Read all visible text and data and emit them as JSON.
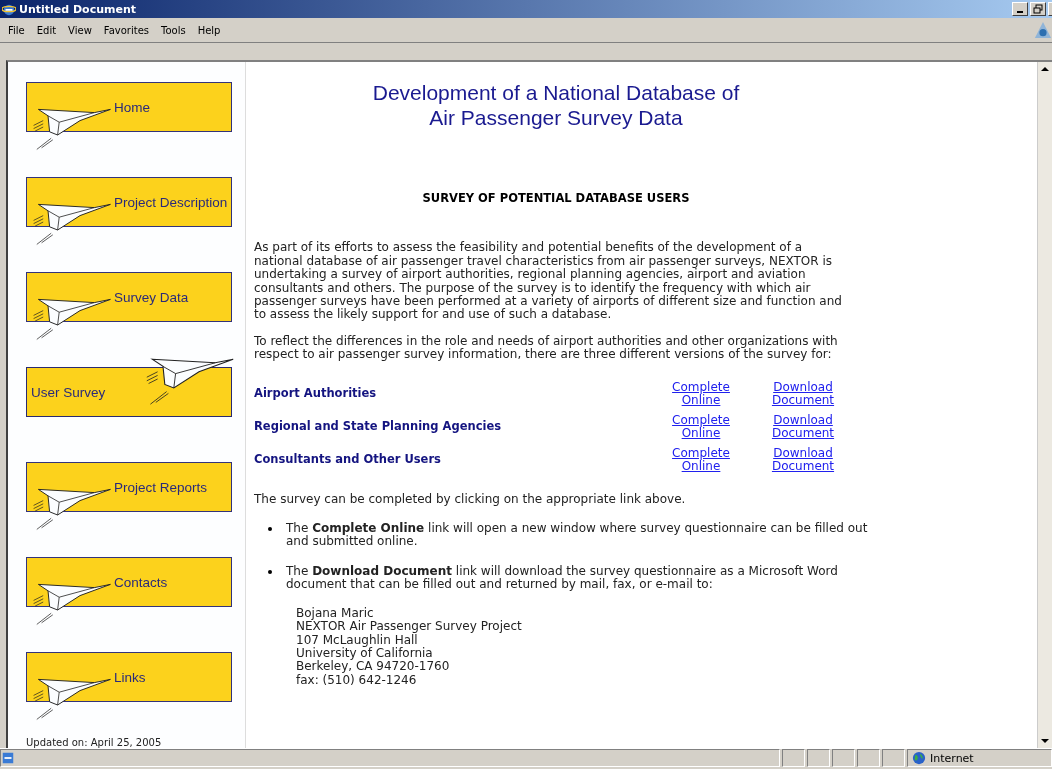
{
  "window": {
    "title": "Untitled Document"
  },
  "menu": [
    "File",
    "Edit",
    "View",
    "Favorites",
    "Tools",
    "Help"
  ],
  "sidebar": {
    "items": [
      {
        "label": "Home",
        "selected": false
      },
      {
        "label": "Project Description",
        "selected": false
      },
      {
        "label": "Survey Data",
        "selected": false
      },
      {
        "label": "User Survey",
        "selected": true
      },
      {
        "label": "Project Reports",
        "selected": false
      },
      {
        "label": "Contacts",
        "selected": false
      },
      {
        "label": "Links",
        "selected": false
      }
    ],
    "updated": "Updated on: April 25, 2005"
  },
  "page": {
    "title": "Development of a National Database of\nAir Passenger Survey Data",
    "heading": "SURVEY OF POTENTIAL DATABASE USERS",
    "paragraphs": [
      "As part of its efforts to assess the feasibility and potential benefits of the development of a national database of air passenger travel characteristics from air passenger surveys, NEXTOR is undertaking a survey of airport authorities, regional planning agencies, airport and aviation consultants and others. The purpose of the survey is to identify the frequency with which air passenger surveys have been performed at a variety of airports of different size and function and to assess the likely support for and use of such a database.",
      "To reflect the differences in the role and needs of airport authorities and other organizations with respect to air passenger survey information, there are three different versions of the survey for:"
    ],
    "versions": [
      {
        "group": "Airport Authorities",
        "online_link": "Complete\nOnline",
        "download_link": "Download\nDocument"
      },
      {
        "group": "Regional and State Planning Agencies",
        "online_link": "Complete\nOnline",
        "download_link": "Download\nDocument"
      },
      {
        "group": "Consultants and Other Users",
        "online_link": "Complete\nOnline",
        "download_link": "Download\nDocument"
      }
    ],
    "instruction": "The survey can be completed by clicking on the appropriate link above.",
    "bullets": [
      "The **Complete Online** link will open a new window where survey questionnaire can be filled out and submitted online.",
      "The **Download Document** link will download the survey questionnaire as a Microsoft Word document that can be filled out and returned by mail, fax, or e-mail to:"
    ],
    "address": [
      "Bojana Maric",
      "NEXTOR Air Passenger Survey Project",
      "107 McLaughlin Hall",
      "University of California",
      "Berkeley, CA 94720-1760",
      "fax: (510) 642-1246"
    ]
  },
  "status_bar": {
    "zone": "Internet"
  }
}
